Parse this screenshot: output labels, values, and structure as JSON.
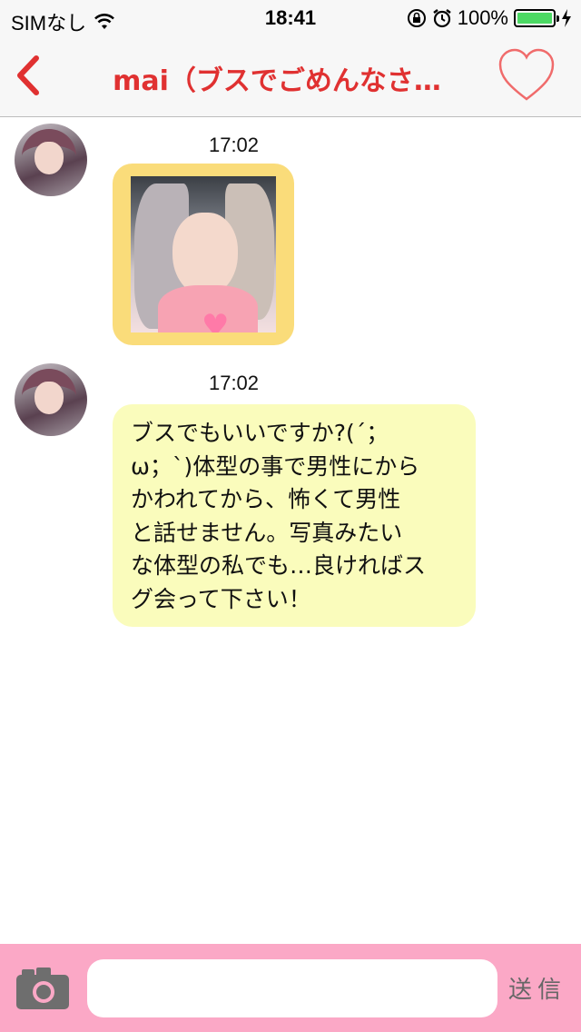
{
  "status_bar": {
    "carrier": "SIMなし",
    "time": "18:41",
    "battery": "100%",
    "battery_level": 1.0
  },
  "nav": {
    "title": "mai（ブスでごめんなさ…",
    "accent_color": "#e03131",
    "back_icon": "chevron-left-icon",
    "favorite_icon": "heart-outline-icon"
  },
  "messages": [
    {
      "type": "image",
      "time": "17:02",
      "bubble_color": "#fadc7a"
    },
    {
      "type": "text",
      "time": "17:02",
      "text": "ブスでもいいですか?(´；\nω；`)体型の事で男性にから\nかわれてから、怖くて男性\nと話せません。写真みたい\nな体型の私でも…良ければス\nグ会って下さい！",
      "bubble_color": "#fafcbc"
    }
  ],
  "input_bar": {
    "placeholder": "",
    "value": "",
    "send_label": "送信",
    "camera_icon": "camera-icon",
    "background": "#fba8c6"
  }
}
